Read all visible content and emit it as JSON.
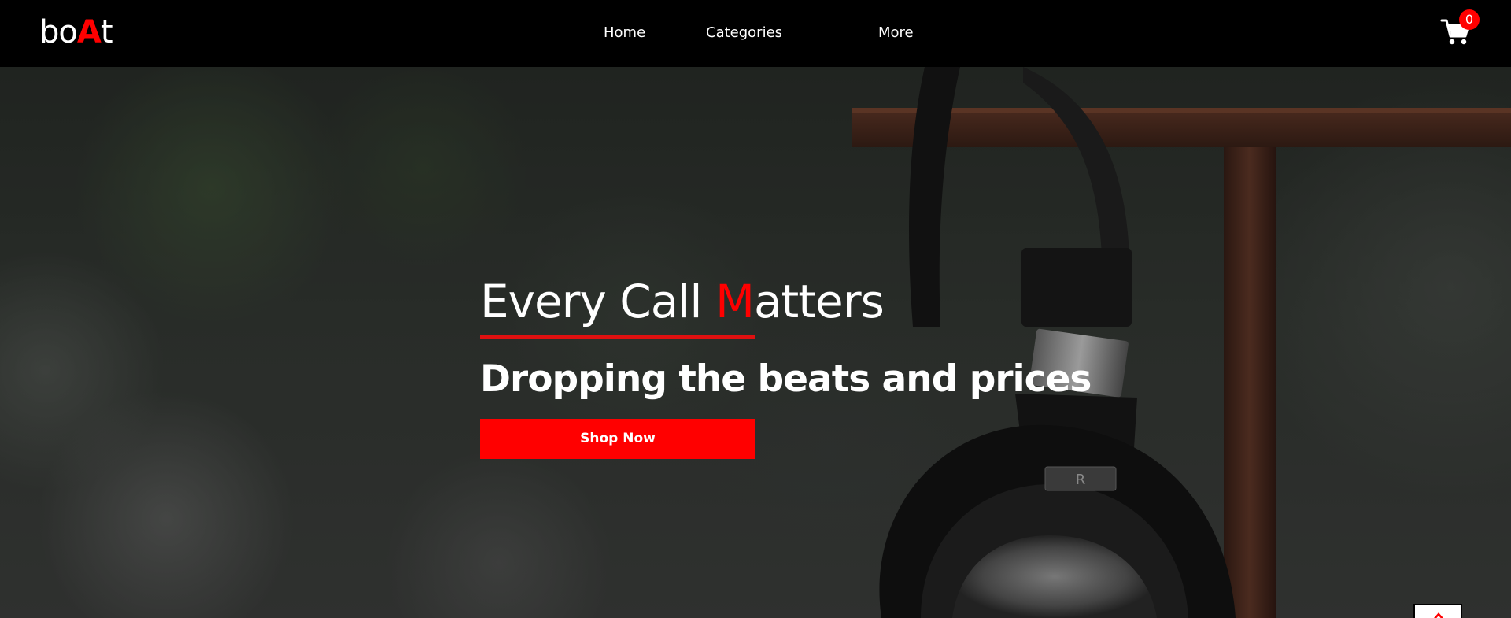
{
  "header": {
    "logo": {
      "prefix": "bo",
      "accent": "A",
      "suffix": "t"
    },
    "nav": {
      "home": "Home",
      "categories": "Categories",
      "more": "More"
    },
    "cart": {
      "count": "0",
      "icon": "cart-icon"
    }
  },
  "hero": {
    "heading_prefix": "Every Call ",
    "heading_accent": "M",
    "heading_suffix": "atters",
    "subheading": "Dropping the beats and prices",
    "cta_label": "Shop Now"
  },
  "scroll_top": {
    "icon": "chevron-up-icon"
  },
  "colors": {
    "accent": "#ff0000",
    "header_bg": "#000000",
    "text": "#ffffff"
  }
}
